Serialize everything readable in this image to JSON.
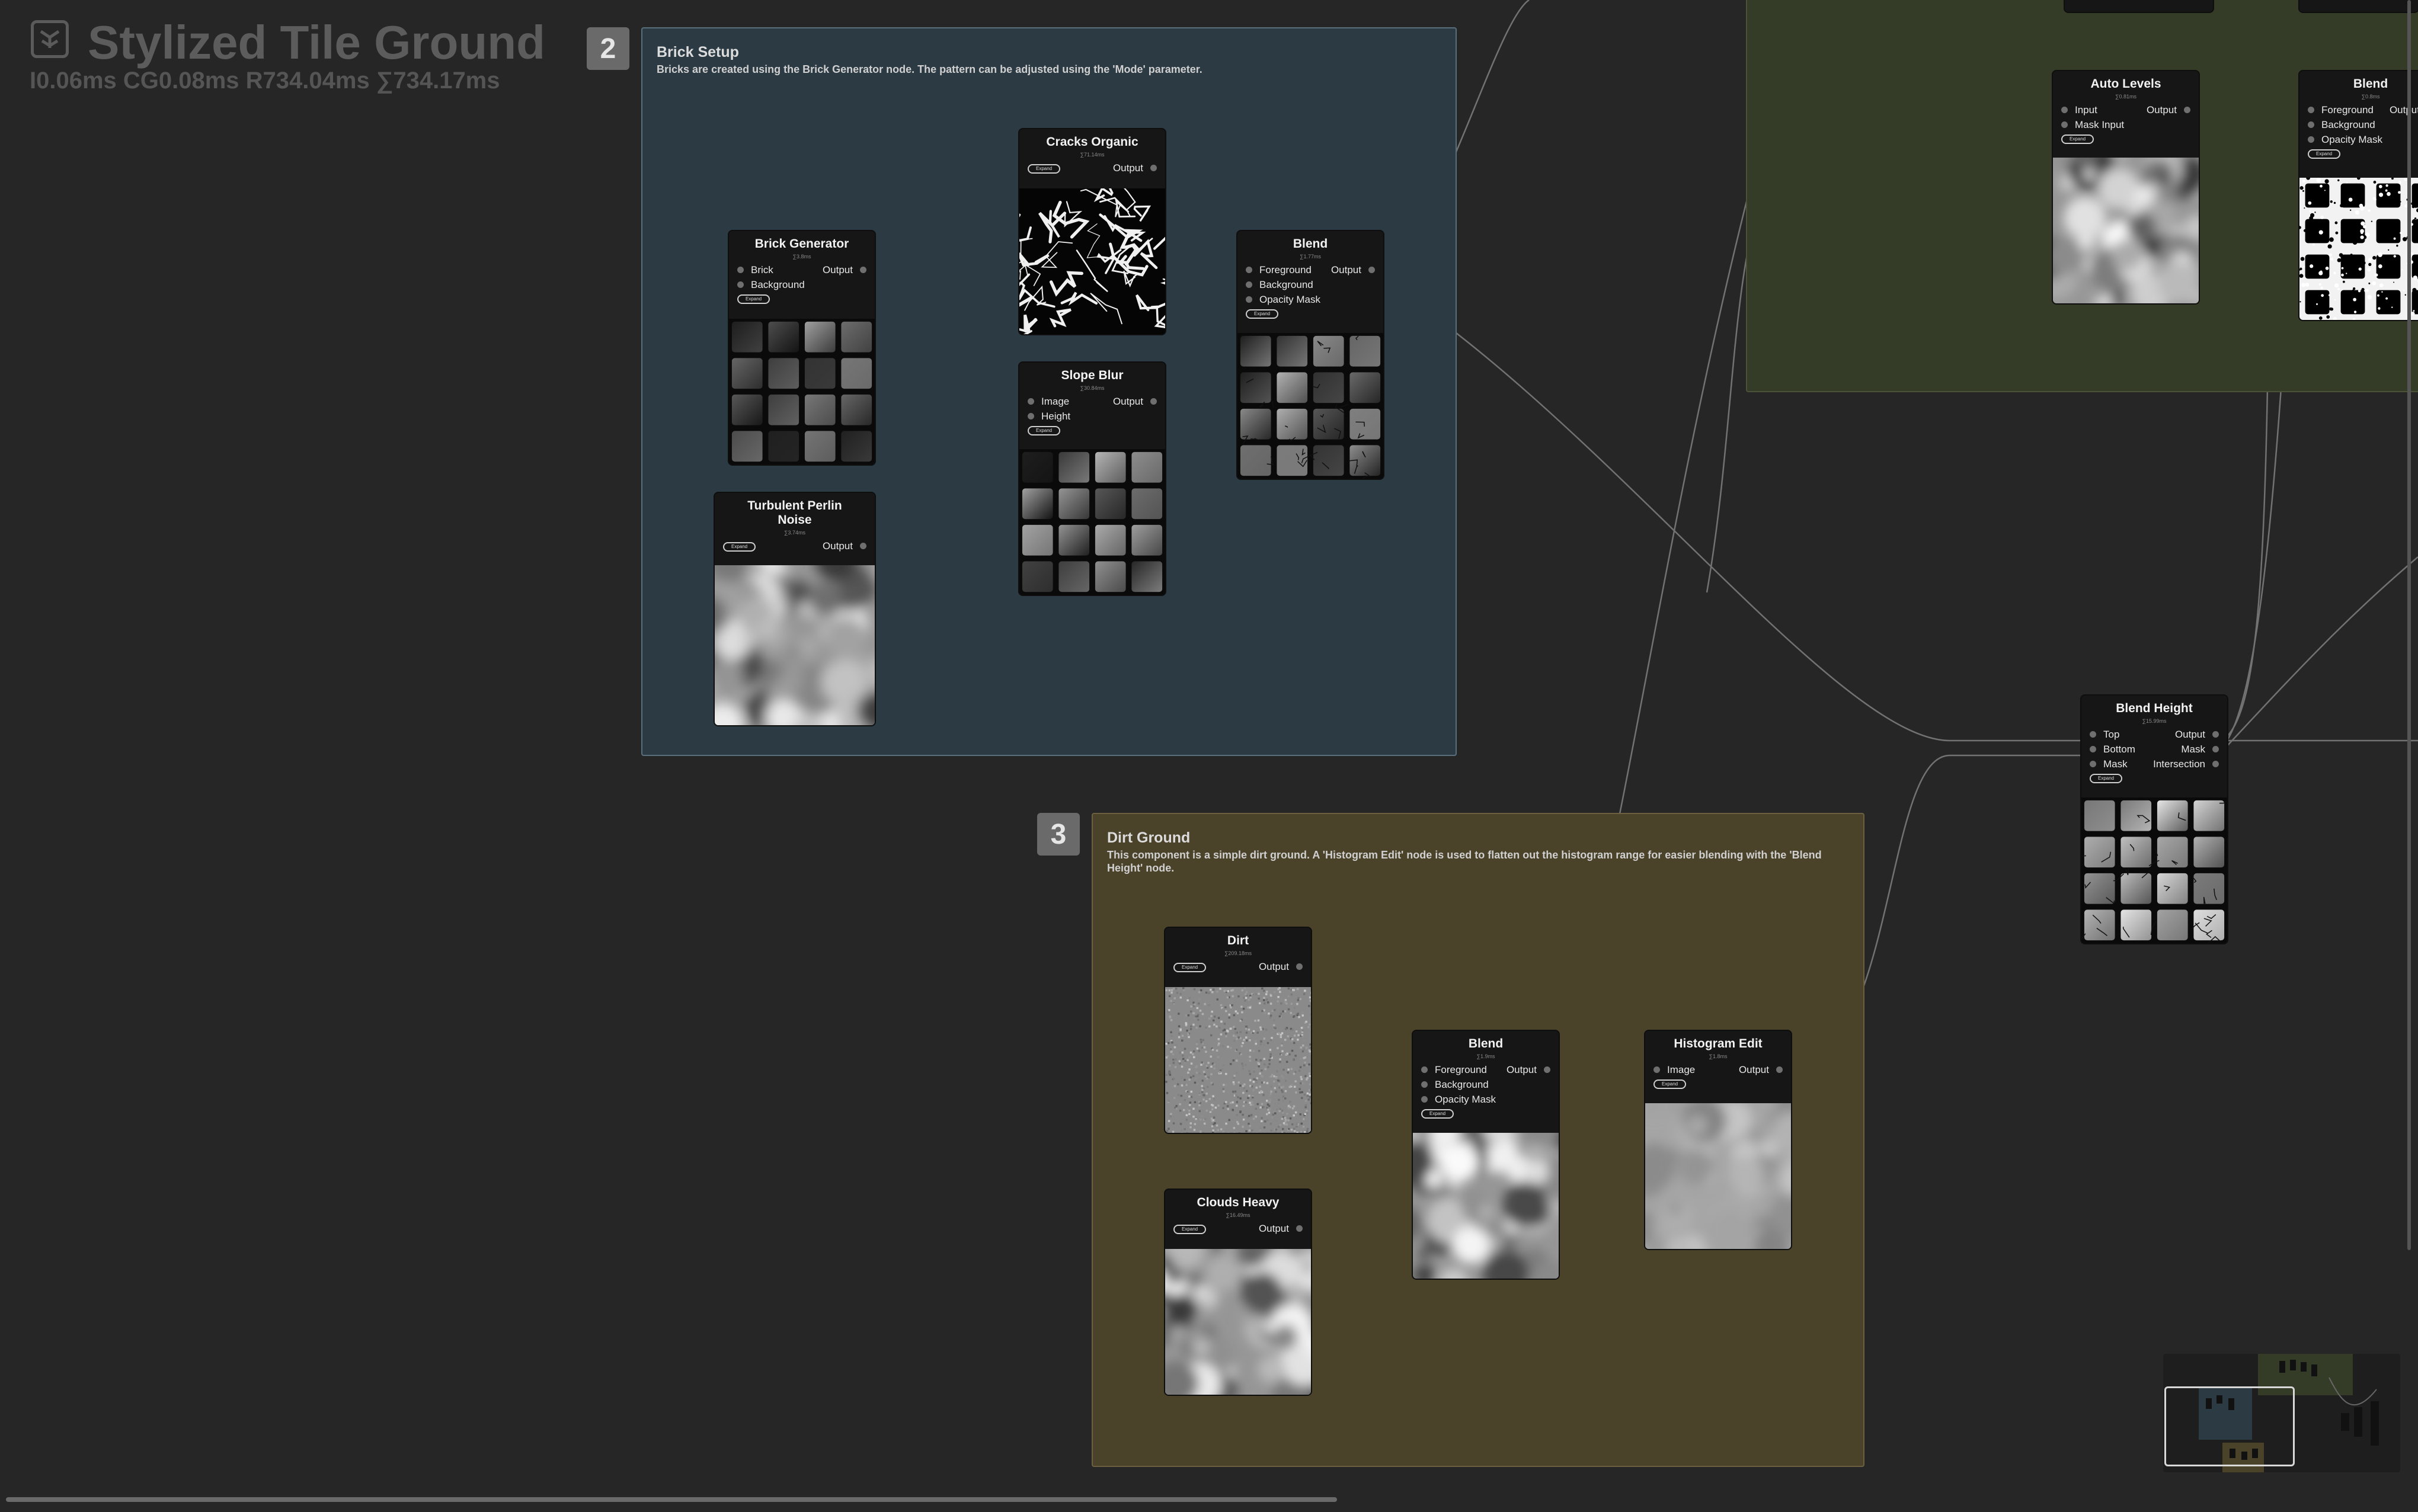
{
  "graph": {
    "title": "Stylized Tile Ground",
    "timing": "I0.06ms CG0.08ms R734.04ms ∑734.17ms"
  },
  "frames": {
    "brick": {
      "number": "2",
      "title": "Brick Setup",
      "description": "Bricks are created using the Brick Generator node. The pattern can be adjusted using the 'Mode' parameter."
    },
    "dirt": {
      "number": "3",
      "title": "Dirt Ground",
      "description": "This component is a simple dirt ground. A 'Histogram Edit' node is used to flatten out the histogram range for easier blending with the 'Blend Height' node."
    }
  },
  "nodes": {
    "brick_generator": {
      "title": "Brick Generator",
      "time": "∑3.8ms",
      "inputs": [
        "Brick",
        "Background"
      ],
      "output": "Output",
      "expand": "Expand",
      "preview": "tiles-soft"
    },
    "turbulent_perlin": {
      "title": "Turbulent Perlin Noise",
      "time": "∑3.74ms",
      "inputs": [],
      "output": "Output",
      "expand": "Expand",
      "preview": "clouds"
    },
    "cracks_organic": {
      "title": "Cracks Organic",
      "time": "∑71.14ms",
      "inputs": [],
      "output": "Output",
      "expand": "Expand",
      "preview": "cracks"
    },
    "slope_blur": {
      "title": "Slope Blur",
      "time": "∑30.84ms",
      "inputs": [
        "Image",
        "Height"
      ],
      "output": "Output",
      "expand": "Expand",
      "preview": "tiles-soft"
    },
    "blend_brick": {
      "title": "Blend",
      "time": "∑1.77ms",
      "inputs": [
        "Foreground",
        "Background",
        "Opacity Mask"
      ],
      "output": "Output",
      "expand": "Expand",
      "preview": "tiles-cracked"
    },
    "auto_levels": {
      "title": "Auto Levels",
      "time": "∑0.81ms",
      "inputs": [
        "Input",
        "Mask Input"
      ],
      "output": "Output",
      "expand": "Expand",
      "preview": "clouds"
    },
    "blend_top": {
      "title": "Blend",
      "time": "∑0.8ms",
      "inputs": [
        "Foreground",
        "Background",
        "Opacity Mask"
      ],
      "output": "Output",
      "expand": "Expand",
      "preview": "mask-grid"
    },
    "blend_height": {
      "title": "Blend Height",
      "time": "∑15.99ms",
      "inputs": [
        "Top",
        "Bottom",
        "Mask"
      ],
      "outputs": [
        "Output",
        "Mask",
        "Intersection"
      ],
      "expand": "Expand",
      "preview": "tiles-bright"
    },
    "dirt": {
      "title": "Dirt",
      "time": "∑209.18ms",
      "inputs": [],
      "output": "Output",
      "expand": "Expand",
      "preview": "dirt"
    },
    "clouds_heavy": {
      "title": "Clouds Heavy",
      "time": "∑16.49ms",
      "inputs": [],
      "output": "Output",
      "expand": "Expand",
      "preview": "clouds"
    },
    "blend_dirt": {
      "title": "Blend",
      "time": "∑1.9ms",
      "inputs": [
        "Foreground",
        "Background",
        "Opacity Mask"
      ],
      "output": "Output",
      "expand": "Expand",
      "preview": "clouds"
    },
    "histogram_edit": {
      "title": "Histogram Edit",
      "time": "∑1.8ms",
      "inputs": [
        "Image"
      ],
      "output": "Output",
      "expand": "Expand",
      "preview": "flat-clouds"
    }
  },
  "colors": {
    "canvas": "#262626",
    "brick_frame": "#2c3a44",
    "dirt_frame": "#4a4229",
    "top_frame": "#343c27",
    "node_bg": "#161616",
    "wire": "#6c6c6c"
  }
}
